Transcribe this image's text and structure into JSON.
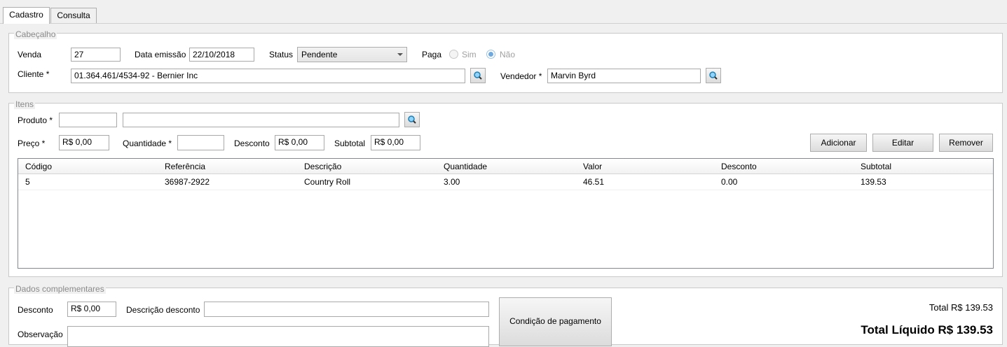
{
  "tabs": [
    "Cadastro",
    "Consulta"
  ],
  "cabecalho": {
    "legend": "Cabeçalho",
    "venda_label": "Venda",
    "venda_value": "27",
    "data_label": "Data emissão",
    "data_value": "22/10/2018",
    "status_label": "Status",
    "status_value": "Pendente",
    "paga_label": "Paga",
    "sim_label": "Sim",
    "nao_label": "Não",
    "cliente_label": "Cliente *",
    "cliente_value": "01.364.461/4534-92 - Bernier Inc",
    "vendedor_label": "Vendedor *",
    "vendedor_value": "Marvin Byrd"
  },
  "itens": {
    "legend": "Itens",
    "produto_label": "Produto *",
    "produto_code": "",
    "produto_desc": "",
    "preco_label": "Preço *",
    "preco_value": "R$ 0,00",
    "quantidade_label": "Quantidade *",
    "quantidade_value": "",
    "desconto_label": "Desconto",
    "desconto_value": "R$ 0,00",
    "subtotal_label": "Subtotal",
    "subtotal_value": "R$ 0,00",
    "btn_adicionar": "Adicionar",
    "btn_editar": "Editar",
    "btn_remover": "Remover",
    "columns": [
      "Código",
      "Referência",
      "Descrição",
      "Quantidade",
      "Valor",
      "Desconto",
      "Subtotal"
    ],
    "rows": [
      [
        "5",
        "36987-2922",
        "Country Roll",
        "3.00",
        "46.51",
        "0.00",
        "139.53"
      ]
    ]
  },
  "complementares": {
    "legend": "Dados complementares",
    "desconto_label": "Desconto",
    "desconto_value": "R$ 0,00",
    "descricao_label": "Descrição desconto",
    "descricao_value": "",
    "observacao_label": "Observação",
    "condicao_button": "Condição de pagamento",
    "total_text": "Total R$ 139.53",
    "total_liquido_text": "Total Líquido R$ 139.53"
  },
  "colors": {
    "search_icon": "#1f7fb0",
    "radio_selected": "#6fa8dc"
  }
}
